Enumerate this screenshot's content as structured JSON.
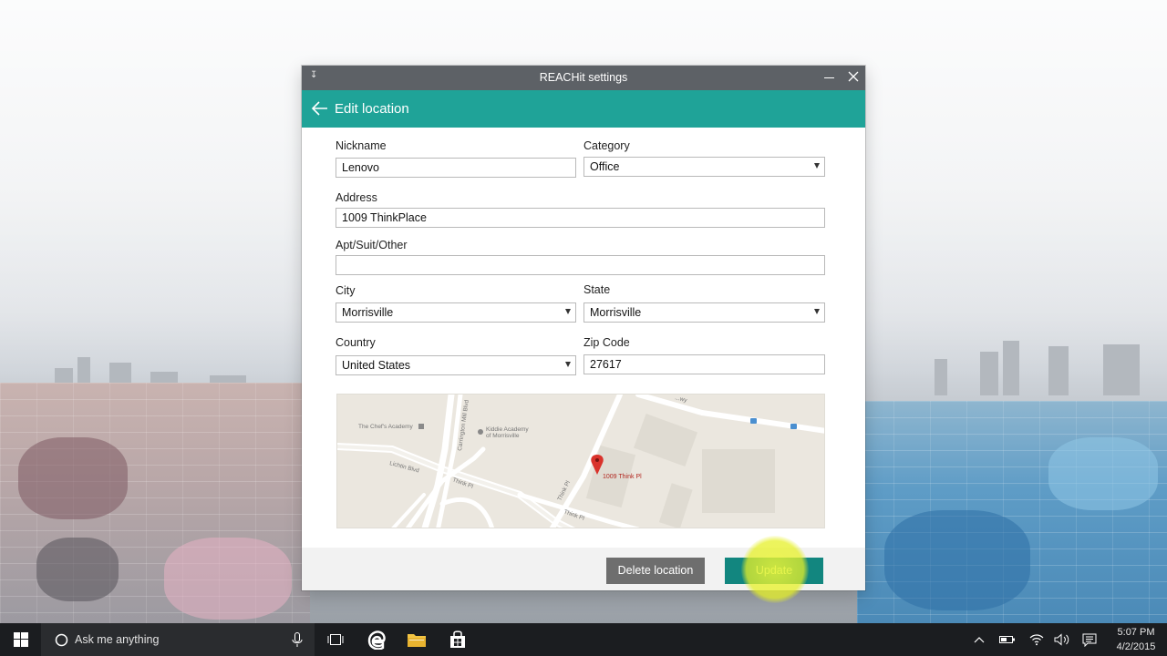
{
  "window": {
    "title": "REACHit settings",
    "header_title": "Edit location"
  },
  "form": {
    "nickname_label": "Nickname",
    "nickname_value": "Lenovo",
    "category_label": "Category",
    "category_value": "Office",
    "address_label": "Address",
    "address_value": "1009 ThinkPlace",
    "apt_label": "Apt/Suit/Other",
    "apt_value": "",
    "city_label": "City",
    "city_value": "Morrisville",
    "state_label": "State",
    "state_value": "Morrisville",
    "country_label": "Country",
    "country_value": "United States",
    "zip_label": "Zip Code",
    "zip_value": "27617"
  },
  "map": {
    "labels": {
      "chefs_academy": "The Chef's Academy",
      "carrington_mill": "Carrington Mill Blvd",
      "kiddie_academy_1": "Kiddie Academy",
      "kiddie_academy_2": "of Morrisville",
      "lichtin": "Lichtin Blvd",
      "think_pl_1": "Think Pl",
      "think_pl_2": "Think Pl",
      "think_pl_3": "Think Pl",
      "marker_label": "1009 Think Pl",
      "top_road": "...wy"
    }
  },
  "buttons": {
    "delete_label": "Delete location",
    "update_label": "Update"
  },
  "taskbar": {
    "search_placeholder": "Ask me anything",
    "time": "5:07 PM",
    "date": "4/2/2015"
  },
  "colors": {
    "header_teal": "#1fa398",
    "update_button": "#12867f",
    "delete_button": "#6e6e6e",
    "titlebar": "#5d6166",
    "marker_red": "#d9322b",
    "highlight_yellow": "#ecf637"
  }
}
